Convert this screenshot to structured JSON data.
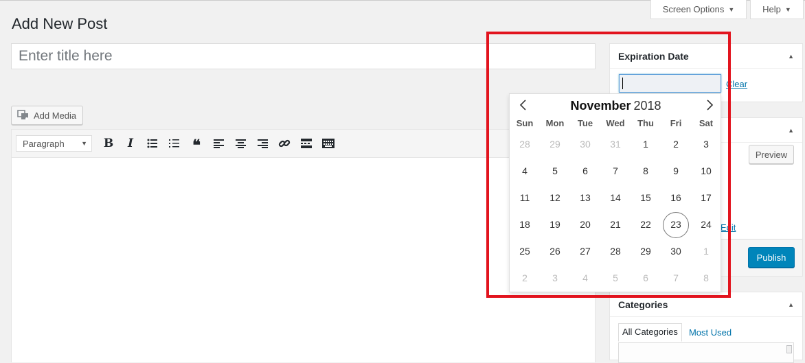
{
  "screen_options_label": "Screen Options",
  "help_label": "Help",
  "page_title": "Add New Post",
  "title_placeholder": "Enter title here",
  "add_media_label": "Add Media",
  "editor": {
    "format_select": "Paragraph",
    "tools": [
      "bold",
      "italic",
      "bulleted-list",
      "numbered-list",
      "blockquote",
      "align-left",
      "align-center",
      "align-right",
      "link",
      "read-more",
      "toolbar-toggle"
    ]
  },
  "expiration": {
    "heading": "Expiration Date",
    "input_value": "",
    "clear_label": "Clear"
  },
  "publish": {
    "preview_label": "Preview",
    "edit_label": "Edit",
    "publish_label": "Publish"
  },
  "categories": {
    "heading": "Categories",
    "tab_all": "All Categories",
    "tab_most_used": "Most Used"
  },
  "calendar": {
    "month": "November",
    "year": "2018",
    "weekdays": [
      "Sun",
      "Mon",
      "Tue",
      "Wed",
      "Thu",
      "Fri",
      "Sat"
    ],
    "days": [
      {
        "d": "28",
        "m": true
      },
      {
        "d": "29",
        "m": true
      },
      {
        "d": "30",
        "m": true
      },
      {
        "d": "31",
        "m": true
      },
      {
        "d": "1"
      },
      {
        "d": "2"
      },
      {
        "d": "3"
      },
      {
        "d": "4"
      },
      {
        "d": "5"
      },
      {
        "d": "6"
      },
      {
        "d": "7"
      },
      {
        "d": "8"
      },
      {
        "d": "9"
      },
      {
        "d": "10"
      },
      {
        "d": "11"
      },
      {
        "d": "12"
      },
      {
        "d": "13"
      },
      {
        "d": "14"
      },
      {
        "d": "15"
      },
      {
        "d": "16"
      },
      {
        "d": "17"
      },
      {
        "d": "18"
      },
      {
        "d": "19"
      },
      {
        "d": "20"
      },
      {
        "d": "21"
      },
      {
        "d": "22"
      },
      {
        "d": "23",
        "today": true
      },
      {
        "d": "24"
      },
      {
        "d": "25"
      },
      {
        "d": "26"
      },
      {
        "d": "27"
      },
      {
        "d": "28"
      },
      {
        "d": "29"
      },
      {
        "d": "30"
      },
      {
        "d": "1",
        "m": true
      },
      {
        "d": "2",
        "m": true
      },
      {
        "d": "3",
        "m": true
      },
      {
        "d": "4",
        "m": true
      },
      {
        "d": "5",
        "m": true
      },
      {
        "d": "6",
        "m": true
      },
      {
        "d": "7",
        "m": true
      },
      {
        "d": "8",
        "m": true
      }
    ]
  },
  "colors": {
    "accent": "#0073aa",
    "highlight": "#e2141e",
    "publish": "#0085ba"
  }
}
